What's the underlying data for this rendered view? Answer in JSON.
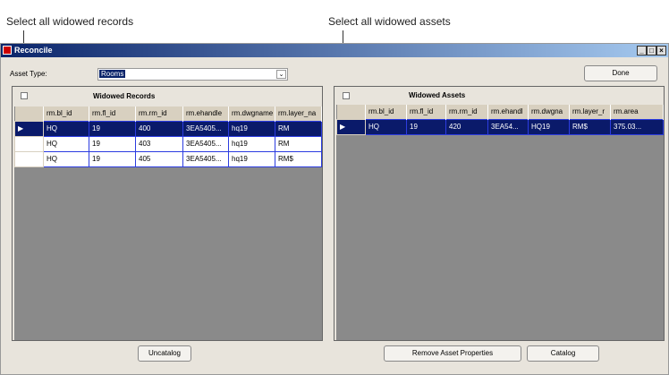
{
  "callouts": {
    "left": "Select all widowed records",
    "right": "Select all widowed assets"
  },
  "window": {
    "title": "Reconcile",
    "minimize": "_",
    "maximize": "□",
    "close": "×"
  },
  "asset_type": {
    "label": "Asset Type:",
    "value": "Rooms"
  },
  "done_label": "Done",
  "left": {
    "title": "Widowed Records",
    "columns": [
      "rm.bl_id",
      "rm.fl_id",
      "rm.rm_id",
      "rm.ehandle",
      "rm.dwgname",
      "rm.layer_na"
    ],
    "rows": [
      [
        "HQ",
        "19",
        "400",
        "3EA5405...",
        "hq19",
        "RM"
      ],
      [
        "HQ",
        "19",
        "403",
        "3EA5405...",
        "hq19",
        "RM"
      ],
      [
        "HQ",
        "19",
        "405",
        "3EA5405...",
        "hq19",
        "RM$"
      ]
    ],
    "selected_row": 0,
    "buttons": {
      "uncatalog": "Uncatalog"
    }
  },
  "right": {
    "title": "Widowed Assets",
    "columns": [
      "rm.bl_id",
      "rm.fl_id",
      "rm.rm_id",
      "rm.ehandl",
      "rm.dwgna",
      "rm.layer_r",
      "rm.area"
    ],
    "rows": [
      [
        "HQ",
        "19",
        "420",
        "3EA54...",
        "HQ19",
        "RM$",
        "375.03..."
      ]
    ],
    "selected_row": 0,
    "buttons": {
      "remove": "Remove Asset Properties",
      "catalog": "Catalog"
    }
  },
  "colors": {
    "selection": "#0a1a6a",
    "grid_border": "#2c3ce0",
    "title_bar": "#0a246a"
  }
}
